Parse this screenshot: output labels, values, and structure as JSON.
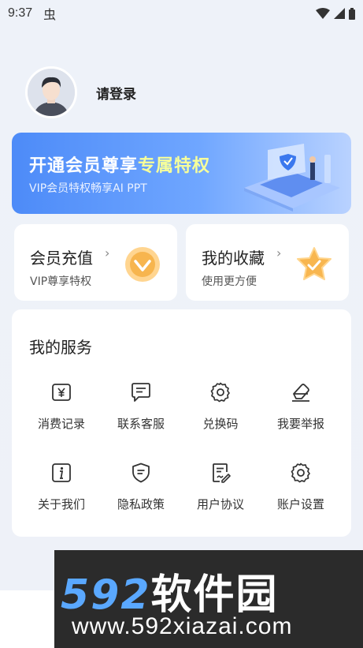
{
  "status_bar": {
    "time": "9:37",
    "bug_glyph": "虫"
  },
  "profile": {
    "login_text": "请登录"
  },
  "vip_banner": {
    "title_part1": "开通会员尊享",
    "title_part2": "专属特权",
    "subtitle": "VIP会员特权畅享AI PPT"
  },
  "cards": [
    {
      "title": "会员充值",
      "subtitle": "VIP尊享特权",
      "icon": "vip-gem-icon"
    },
    {
      "title": "我的收藏",
      "subtitle": "使用更方便",
      "icon": "star-check-icon"
    }
  ],
  "services": {
    "title": "我的服务",
    "items": [
      {
        "label": "消费记录",
        "icon": "receipt-yen-icon"
      },
      {
        "label": "联系客服",
        "icon": "chat-icon"
      },
      {
        "label": "兑换码",
        "icon": "gear-icon"
      },
      {
        "label": "我要举报",
        "icon": "eraser-icon"
      },
      {
        "label": "关于我们",
        "icon": "info-icon"
      },
      {
        "label": "隐私政策",
        "icon": "shield-icon"
      },
      {
        "label": "用户协议",
        "icon": "document-edit-icon"
      },
      {
        "label": "账户设置",
        "icon": "settings-icon"
      }
    ]
  },
  "watermark": {
    "line1_num": "592",
    "line1_cn": "软件园",
    "line2": "www.592xiazai.com"
  }
}
